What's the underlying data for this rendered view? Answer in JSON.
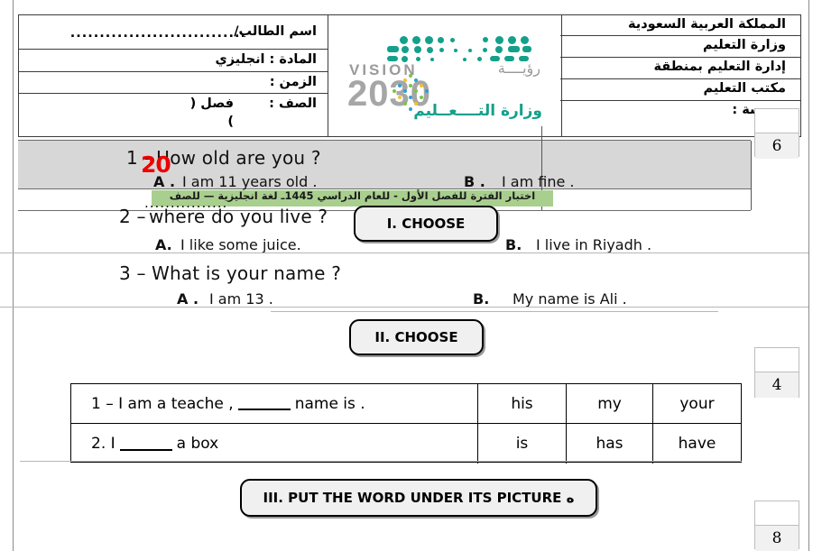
{
  "header": {
    "left_col": {
      "student_name_label": "اسم الطالب/",
      "student_name_dots": "..............................",
      "subject_label": "المادة : انجليزي",
      "time_label": "الزمن :",
      "grade_label": "الصف :",
      "section_label": "فصل (",
      "section_close": ")"
    },
    "logo": {
      "vision_en": "VISION",
      "vision_ar": "رؤيــــة",
      "year": "2030",
      "ministry_ar": "وزارة التــــعــليم"
    },
    "right_col": [
      "المملكة العربية السعودية",
      "وزارة التعليم",
      "إدارة التعليم بمنطقة",
      "مكتب التعليم",
      "مدرسة :"
    ]
  },
  "exam_title_ar": "اختبار الفترة  للفصل الأول - للعام الدراسي 1445ـ لغة انجليزية — للصف",
  "exam_title_dots": "................",
  "red_mark": "20",
  "sections": {
    "one_label": "I. CHOOSE",
    "two_label": "II. CHOOSE",
    "three_label": "III. PUT THE WORD UNDER ITS PICTURE ه"
  },
  "exercise_one": {
    "questions": [
      {
        "number": "1 –",
        "text": "How old are you ?",
        "option_a_letter": "A .",
        "option_a": "I am 11 years old .",
        "option_b_letter": "B .",
        "option_b": "I am fine ."
      },
      {
        "number": "2 –",
        "text": "where do you live ?",
        "option_a_letter": "A.",
        "option_a": "I like some juice.",
        "option_b_letter": "B.",
        "option_b": "I live in Riyadh   ."
      },
      {
        "number": "3 –",
        "text": "What is your name ?",
        "option_a_letter": "A .",
        "option_a": "I am 13  .",
        "option_b_letter": "B.",
        "option_b": "My name is Ali   ."
      }
    ]
  },
  "exercise_two": {
    "rows": [
      {
        "sentence_pre": "1 –   I am a teache ,",
        "sentence_post": "name is  .",
        "choice1": "his",
        "choice2": "my",
        "choice3": "your"
      },
      {
        "sentence_pre": "2. I",
        "sentence_post": "a  box",
        "choice1": "is",
        "choice2": "has",
        "choice3": "have"
      }
    ]
  },
  "score_boxes": {
    "box1": "6",
    "box2": "4",
    "box3": "8"
  },
  "colors": {
    "highlight_green": "#a9cf8f",
    "red_annotation": "#ee0000",
    "band_gray": "#d7d7d7",
    "logo_teal": "#14a08b",
    "logo_gray": "#a6a6a6"
  }
}
